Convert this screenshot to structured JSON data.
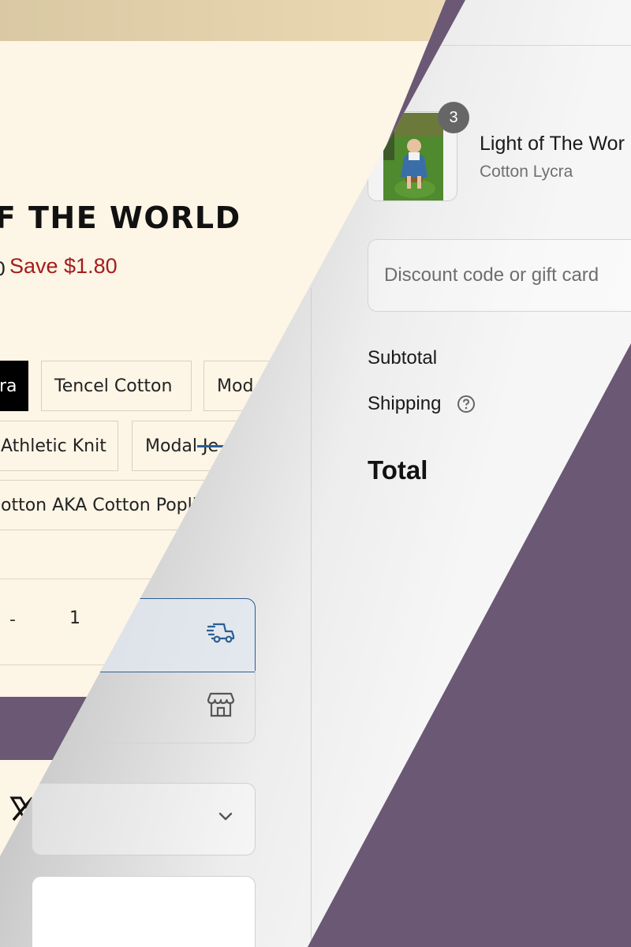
{
  "colors": {
    "cream": "#fdf5e6",
    "purple": "#6a5874",
    "save_red": "#a51c1c",
    "accent_blue": "#2b5e93",
    "text_dark": "#111111",
    "text_muted": "#707070"
  },
  "product": {
    "title": "OF THE WORLD",
    "price_tail": "0",
    "save_label": "Save $1.80",
    "fabrics": [
      {
        "label": "ra",
        "selected": true
      },
      {
        "label": "Tencel Cotton",
        "selected": false
      },
      {
        "label": "Mod",
        "selected": false
      },
      {
        "label": "Athletic Knit",
        "selected": false
      },
      {
        "label": "Modal Je",
        "selected": false
      },
      {
        "label": "otton AKA Cotton Popli",
        "selected": false
      }
    ],
    "quantity": {
      "minus": "-",
      "value": "1"
    }
  },
  "checkout": {
    "item": {
      "quantity_badge": "3",
      "name": "Light of The Wor",
      "variant": "Cotton Lycra"
    },
    "discount_placeholder": "Discount code or gift card",
    "summary": {
      "subtotal_label": "Subtotal",
      "shipping_label": "Shipping",
      "total_label": "Total"
    },
    "delivery_options": [
      {
        "icon": "truck-icon",
        "selected": true
      },
      {
        "icon": "store-icon",
        "selected": false
      }
    ],
    "social_icon": "x-logo",
    "select_icon": "chevron-down-icon"
  }
}
